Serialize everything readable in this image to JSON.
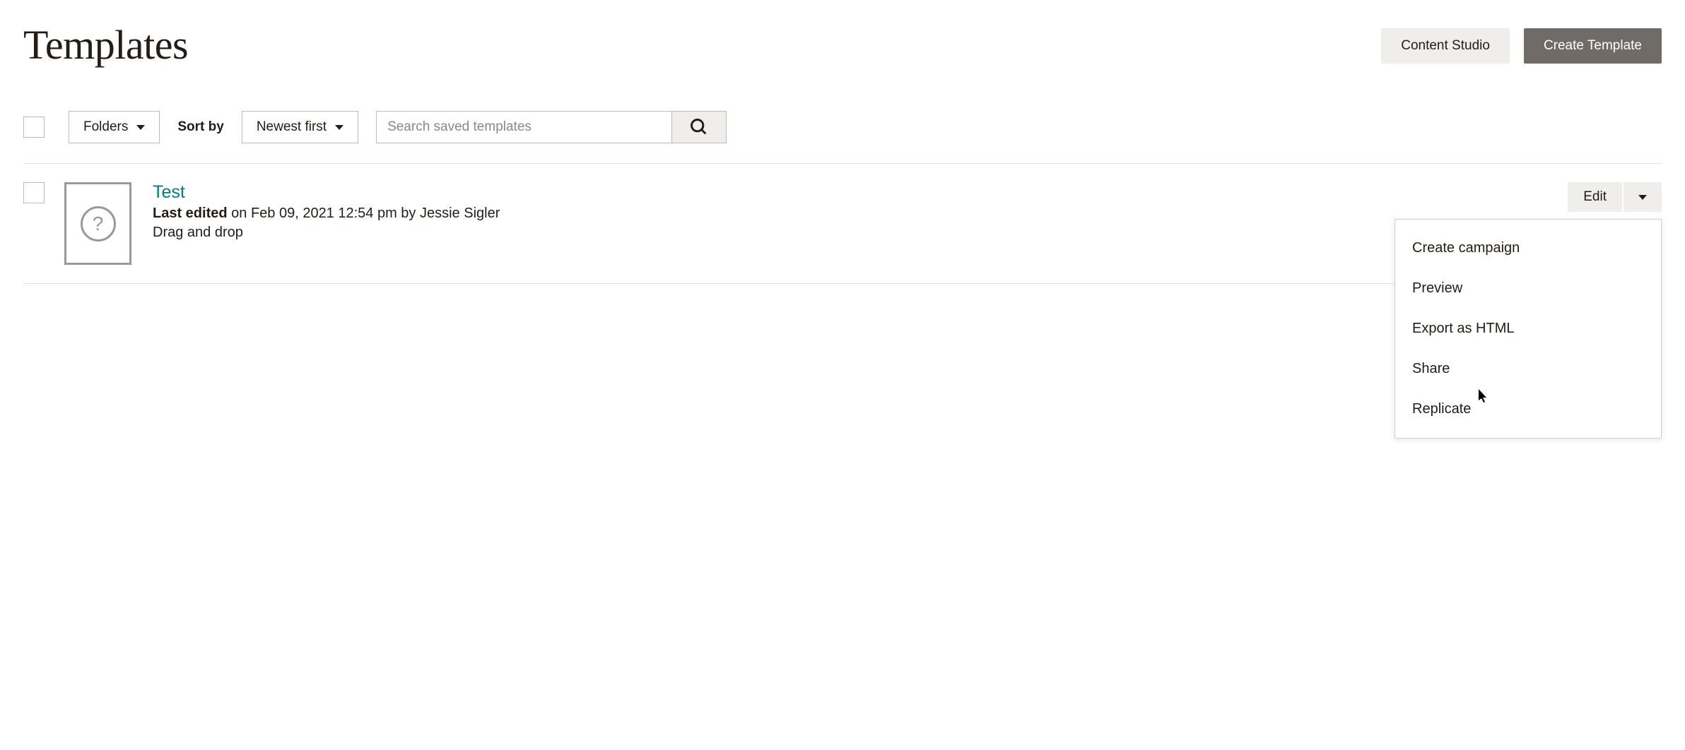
{
  "header": {
    "title": "Templates",
    "content_studio_label": "Content Studio",
    "create_template_label": "Create Template"
  },
  "filters": {
    "folders_label": "Folders",
    "sort_by_label": "Sort by",
    "sort_value": "Newest first",
    "search_placeholder": "Search saved templates"
  },
  "template": {
    "name": "Test",
    "last_edited_label": "Last edited",
    "last_edited_meta": " on Feb 09, 2021 12:54 pm by Jessie Sigler",
    "type": "Drag and drop",
    "edit_label": "Edit"
  },
  "dropdown": {
    "items": [
      "Create campaign",
      "Preview",
      "Export as HTML",
      "Share",
      "Replicate"
    ]
  }
}
